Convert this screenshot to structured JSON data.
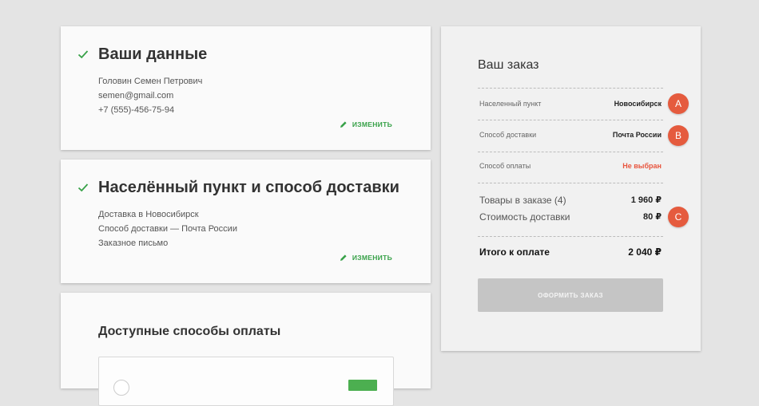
{
  "personal": {
    "title": "Ваши данные",
    "lines": [
      "Головин Семен Петрович",
      "semen@gmail.com",
      "+7 (555)-456-75-94"
    ],
    "edit_label": "ИЗМЕНИТЬ"
  },
  "delivery": {
    "title": "Населённый пункт и способ доставки",
    "lines": [
      "Доставка в Новосибирск",
      "Способ доставки — Почта России",
      "Заказное письмо"
    ],
    "edit_label": "ИЗМЕНИТЬ"
  },
  "payment": {
    "title": "Доступные способы оплаты"
  },
  "order": {
    "title": "Ваш заказ",
    "rows": [
      {
        "label": "Населенный пункт",
        "value": "Новосибирск"
      },
      {
        "label": "Способ доставки",
        "value": "Почта России"
      },
      {
        "label": "Способ оплаты",
        "value": "Не выбран"
      }
    ],
    "goods_label": "Товары в заказе (4)",
    "goods_value": "1 960 ₽",
    "shipping_label": "Стоимость доставки",
    "shipping_value": "80 ₽",
    "total_label": "Итого к оплате",
    "total_value": "2 040 ₽",
    "submit_label": "ОФОРМИТЬ ЗАКАЗ"
  },
  "badges": [
    "A",
    "B",
    "C"
  ],
  "colors": {
    "accent_green": "#37a148",
    "warning_red": "#e8553e",
    "badge": "#e55b3e",
    "button_disabled": "#c5c5c5"
  }
}
